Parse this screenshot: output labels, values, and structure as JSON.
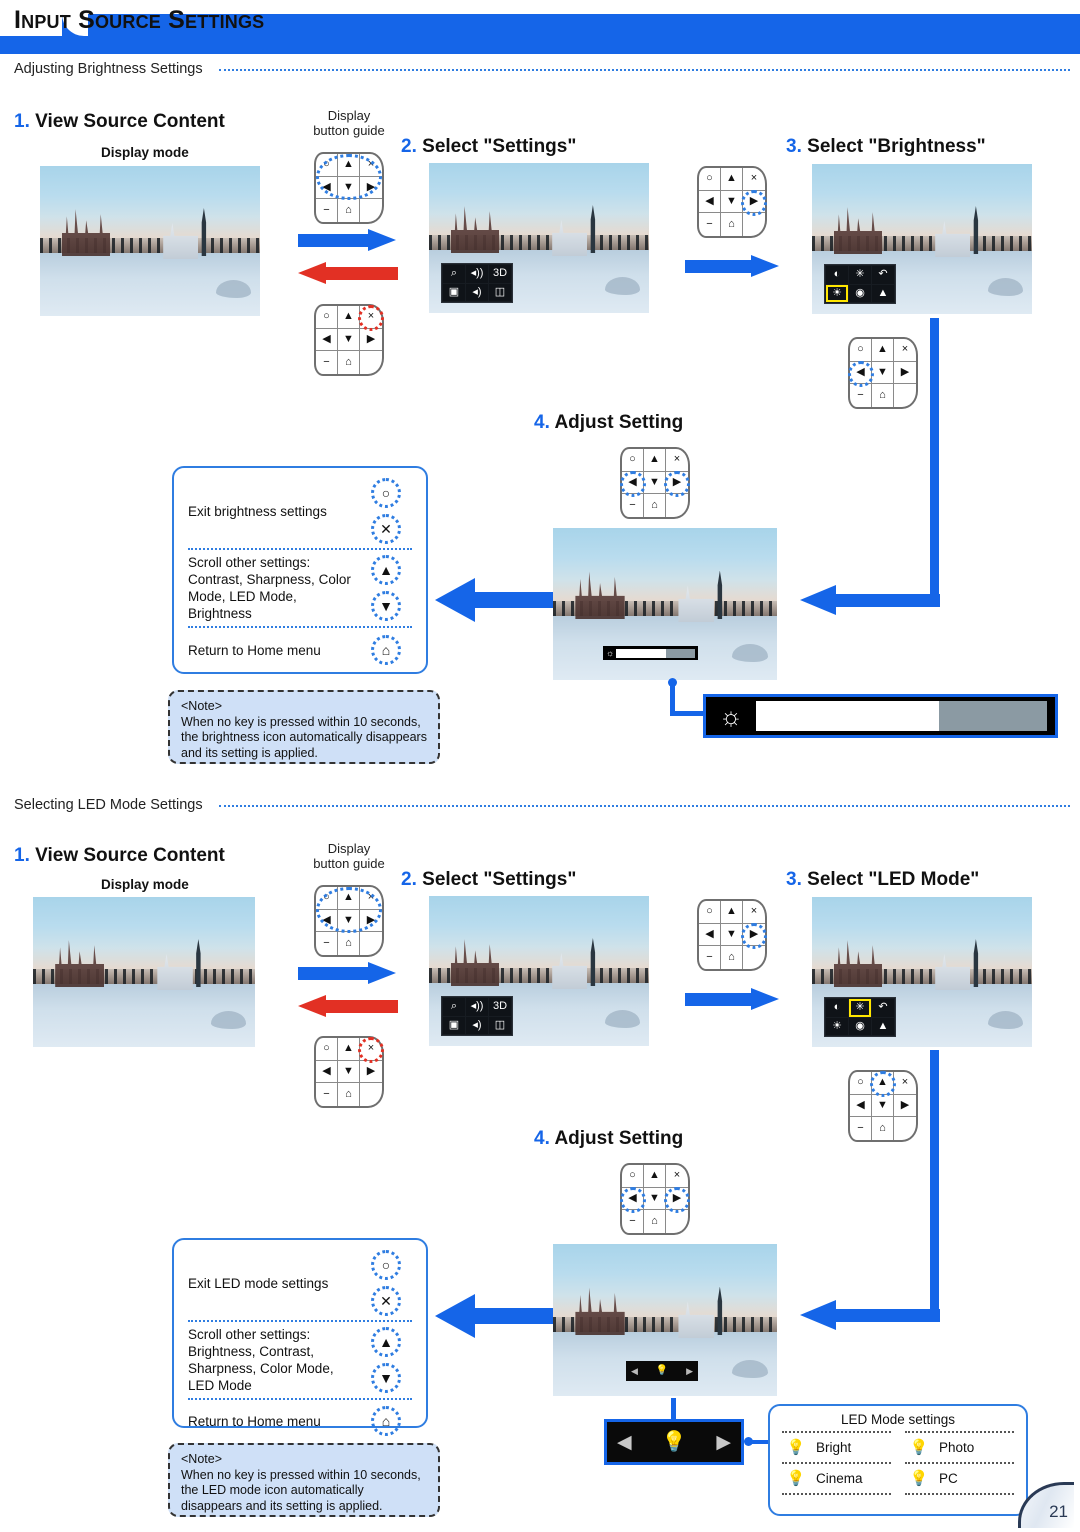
{
  "header": {
    "title": "Input Source Settings",
    "page_number": "21"
  },
  "sections": [
    {
      "id": "brightness",
      "subtitle": "Adjusting Brightness Settings",
      "steps": {
        "s1_num": "1.",
        "s1_label": "View Source Content",
        "s2_num": "2.",
        "s2_label": "Select \"Settings\"",
        "s3_num": "3.",
        "s3_label": "Select \"Brightness\"",
        "s4_num": "4.",
        "s4_label": "Adjust Setting"
      },
      "display_mode_caption": "Display mode",
      "button_guide_caption_l1": "Display",
      "button_guide_caption_l2": "button guide",
      "legend": {
        "row1_text": "Exit brightness settings",
        "row2_text": "Scroll other settings: Contrast, Sharpness, Color Mode, LED Mode, Brightness",
        "row3_text": "Return to Home menu"
      },
      "note": {
        "tag": "<Note>",
        "body": "When no key is pressed within 10 seconds, the brightness icon automatically disappears and its setting is applied."
      },
      "brightness_bar": {
        "fill_percent": 63,
        "icon": "sun-icon"
      }
    },
    {
      "id": "led",
      "subtitle": "Selecting LED Mode Settings",
      "steps": {
        "s1_num": "1.",
        "s1_label": "View Source Content",
        "s2_num": "2.",
        "s2_label": "Select \"Settings\"",
        "s3_num": "3.",
        "s3_label": "Select \"LED Mode\"",
        "s4_num": "4.",
        "s4_label": "Adjust Setting"
      },
      "display_mode_caption": "Display mode",
      "button_guide_caption_l1": "Display",
      "button_guide_caption_l2": "button guide",
      "legend": {
        "row1_text": "Exit LED mode settings",
        "row2_text": "Scroll other settings: Brightness, Contrast, Sharpness, Color Mode, LED Mode",
        "row3_text": "Return to Home menu"
      },
      "note": {
        "tag": "<Note>",
        "body": "When no key is pressed within 10 seconds, the LED mode icon automatically disappears and its setting is applied."
      },
      "led_card": {
        "title": "LED Mode settings",
        "options": [
          {
            "label": "Bright",
            "icon": "bulb-bright-icon"
          },
          {
            "label": "Photo",
            "icon": "bulb-photo-icon"
          },
          {
            "label": "Cinema",
            "icon": "bulb-cinema-icon"
          },
          {
            "label": "PC",
            "icon": "bulb-pc-icon"
          }
        ]
      },
      "led_bar": {
        "left_icon": "prev-triangle-icon",
        "center_icon": "bulb-icon",
        "right_icon": "next-triangle-icon"
      }
    }
  ],
  "keypad": {
    "keys": [
      "○",
      "▲",
      "×",
      "◀",
      "▼",
      "▶",
      "−",
      "⌂"
    ],
    "names": [
      "circle-key",
      "up-key",
      "close-key",
      "left-key",
      "down-key",
      "right-key",
      "minus-key",
      "home-key"
    ]
  },
  "osd": {
    "settings_menu_icons": [
      "⌕",
      "◂))",
      "3D",
      "▣",
      "◂)",
      "◫"
    ],
    "settings_menu_names": [
      "zoom-icon",
      "volume-icon",
      "three-d-icon",
      "screen-icon",
      "audio-icon",
      "picture-icon"
    ],
    "picture_menu_icons": [
      "◐",
      "✳",
      "↶",
      "☀",
      "◉",
      "▲"
    ],
    "picture_menu_names": [
      "contrast-icon",
      "sharpness-icon",
      "return-icon",
      "brightness-icon",
      "color-mode-icon",
      "led-mode-icon"
    ]
  },
  "colors": {
    "banner_blue": "#1565e8",
    "accent_blue": "#2f7de1",
    "arrow_blue": "#1565e8",
    "arrow_red": "#e23024",
    "highlight_yellow": "#ffe600",
    "note_fill": "#cfe0f7"
  }
}
